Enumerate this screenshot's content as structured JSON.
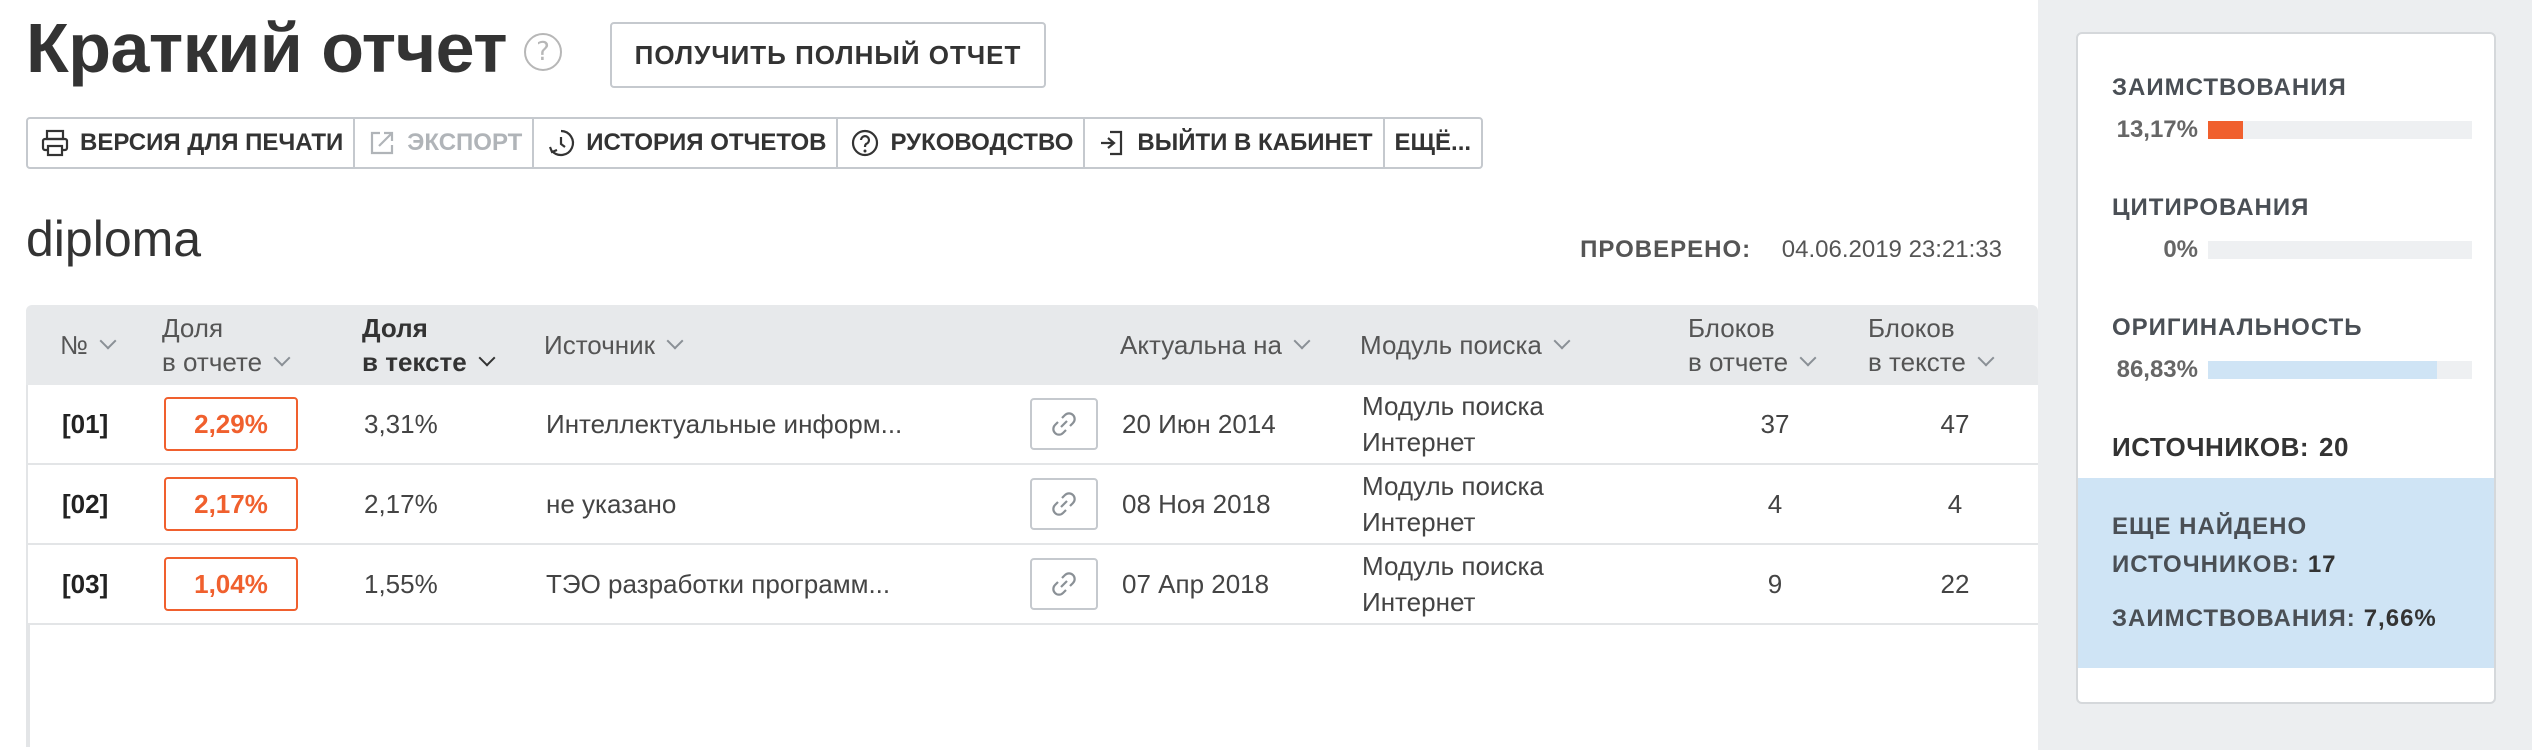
{
  "header": {
    "title": "Краткий отчет",
    "help_icon": "question-circle-icon",
    "full_report_button": "ПОЛУЧИТЬ ПОЛНЫЙ ОТЧЕТ"
  },
  "toolbar": {
    "items": [
      {
        "label": "ВЕРСИЯ ДЛЯ ПЕЧАТИ",
        "icon": "printer-icon",
        "disabled": false
      },
      {
        "label": "ЭКСПОРТ",
        "icon": "export-icon",
        "disabled": true
      },
      {
        "label": "ИСТОРИЯ ОТЧЕТОВ",
        "icon": "history-icon",
        "disabled": false
      },
      {
        "label": "РУКОВОДСТВО",
        "icon": "question-circle-icon",
        "disabled": false
      },
      {
        "label": "ВЫЙТИ В КАБИНЕТ",
        "icon": "exit-icon",
        "disabled": false
      },
      {
        "label": "ЕЩЁ...",
        "icon": "",
        "disabled": false
      }
    ]
  },
  "document": {
    "name": "diploma",
    "checked_label": "ПРОВЕРЕНО:",
    "checked_value": "04.06.2019 23:21:33"
  },
  "table": {
    "headers": {
      "num": "№",
      "share_report_1": "Доля",
      "share_report_2": "в отчете",
      "share_text_1": "Доля",
      "share_text_2": "в тексте",
      "source": "Источник",
      "actual": "Актуальна на",
      "module": "Модуль поиска",
      "blocks_report_1": "Блоков",
      "blocks_report_2": "в отчете",
      "blocks_text_1": "Блоков",
      "blocks_text_2": "в тексте"
    },
    "rows": [
      {
        "num": "[01]",
        "share_report": "2,29%",
        "share_text": "3,31%",
        "source": "Интеллектуальные информ...",
        "actual": "20 Июн 2014",
        "module_1": "Модуль поиска",
        "module_2": "Интернет",
        "blocks_report": "37",
        "blocks_text": "47"
      },
      {
        "num": "[02]",
        "share_report": "2,17%",
        "share_text": "2,17%",
        "source": "не указано",
        "actual": "08 Ноя 2018",
        "module_1": "Модуль поиска",
        "module_2": "Интернет",
        "blocks_report": "4",
        "blocks_text": "4"
      },
      {
        "num": "[03]",
        "share_report": "1,04%",
        "share_text": "1,55%",
        "source": "ТЭО разработки программ...",
        "actual": "07 Апр 2018",
        "module_1": "Модуль поиска",
        "module_2": "Интернет",
        "blocks_report": "9",
        "blocks_text": "22"
      }
    ]
  },
  "summary": {
    "borrowings": {
      "label": "ЗАИМСТВОВАНИЯ",
      "value": "13,17%",
      "fraction": 0.1317,
      "color": "#f0602e"
    },
    "citations": {
      "label": "ЦИТИРОВАНИЯ",
      "value": "0%",
      "fraction": 0,
      "color": "#f0602e"
    },
    "originality": {
      "label": "ОРИГИНАЛЬНОСТЬ",
      "value": "86,83%",
      "fraction": 0.8683,
      "color": "#cfe4f5"
    },
    "sources_label": "ИСТОЧНИКОВ:",
    "sources_value": "20",
    "more_found_line1": "ЕЩЕ НАЙДЕНО",
    "more_found_line2": "ИСТОЧНИКОВ:",
    "more_found_value": "17",
    "more_borrowings_label": "ЗАИМСТВОВАНИЯ:",
    "more_borrowings_value": "7,66%"
  },
  "colors": {
    "accent": "#f0602e",
    "panel_bg": "#eceef0",
    "highlight_bg": "#cfe4f5"
  }
}
